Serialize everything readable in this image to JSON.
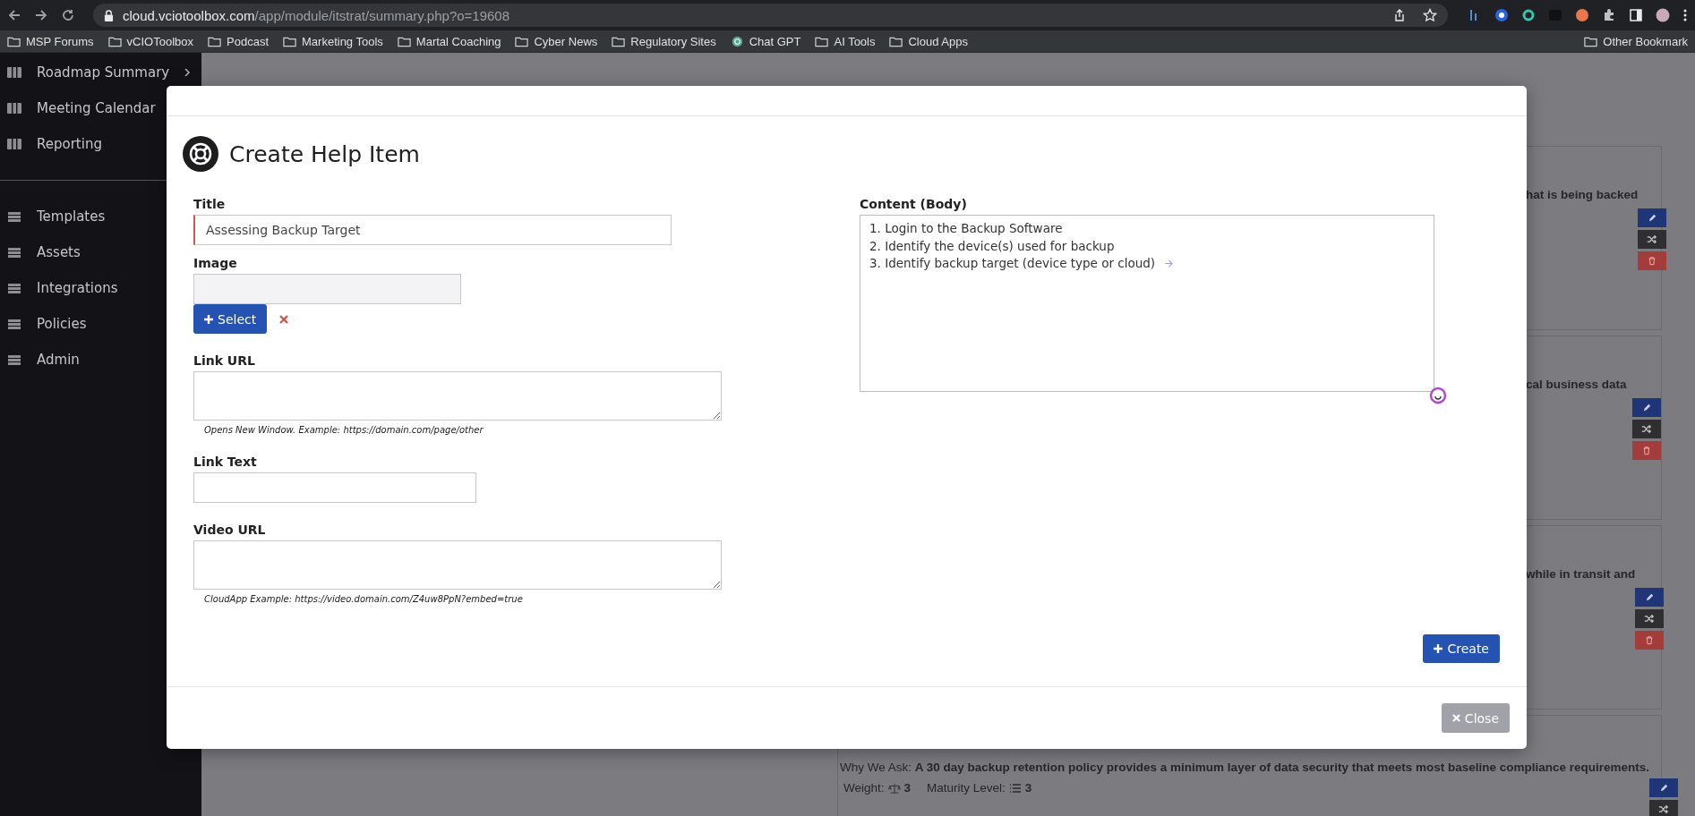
{
  "browser": {
    "url_host": "cloud.vciotoolbox.com",
    "url_path": "/app/module/itstrat/summary.php?o=19608",
    "bookmarks": [
      {
        "label": "MSP Forums",
        "kind": "folder"
      },
      {
        "label": "vCIOToolbox",
        "kind": "folder"
      },
      {
        "label": "Podcast",
        "kind": "folder"
      },
      {
        "label": "Marketing Tools",
        "kind": "folder"
      },
      {
        "label": "Martal Coaching",
        "kind": "folder"
      },
      {
        "label": "Cyber News",
        "kind": "folder"
      },
      {
        "label": "Regulatory Sites",
        "kind": "folder"
      },
      {
        "label": "Chat GPT",
        "kind": "site"
      },
      {
        "label": "AI Tools",
        "kind": "folder"
      },
      {
        "label": "Cloud Apps",
        "kind": "folder"
      }
    ],
    "other_bookmarks": "Other Bookmark"
  },
  "sidebar": {
    "items": [
      {
        "label": "Roadmap Summary",
        "expandable": true
      },
      {
        "label": "Meeting Calendar"
      },
      {
        "label": "Reporting"
      }
    ],
    "items_2": [
      {
        "label": "Templates"
      },
      {
        "label": "Assets"
      },
      {
        "label": "Integrations"
      },
      {
        "label": "Policies"
      },
      {
        "label": "Admin"
      }
    ]
  },
  "cards": [
    {
      "kind": "fragment",
      "text": "hat is being backed"
    },
    {
      "kind": "fragment",
      "text": "cal business data"
    },
    {
      "kind": "fragment",
      "text": "while in transit and"
    },
    {
      "kind": "detail",
      "why_label": "Why We Ask:",
      "why_text": "A 30 day backup retention policy provides a minimum layer of data security that meets most baseline compliance requirements.",
      "weight_label": "Weight:",
      "weight": "3",
      "maturity_label": "Maturity Level:",
      "maturity": "3"
    }
  ],
  "modal": {
    "title": "Create Help Item",
    "title_field": {
      "label": "Title",
      "value": "Assessing Backup Target"
    },
    "image_field": {
      "label": "Image",
      "select_button": "Select"
    },
    "link_url": {
      "label": "Link URL",
      "hint": "Opens New Window. Example: https://domain.com/page/other"
    },
    "link_text": {
      "label": "Link Text"
    },
    "video_url": {
      "label": "Video URL",
      "hint": "CloudApp Example: https://video.domain.com/Z4uw8PpN?embed=true"
    },
    "content": {
      "label": "Content (Body)",
      "lines": [
        "1. Login to the Backup Software",
        "2. Identify the device(s) used for backup",
        "3. Identify backup target  (device type or cloud)"
      ]
    },
    "create_button": "Create",
    "close_button": "Close"
  }
}
